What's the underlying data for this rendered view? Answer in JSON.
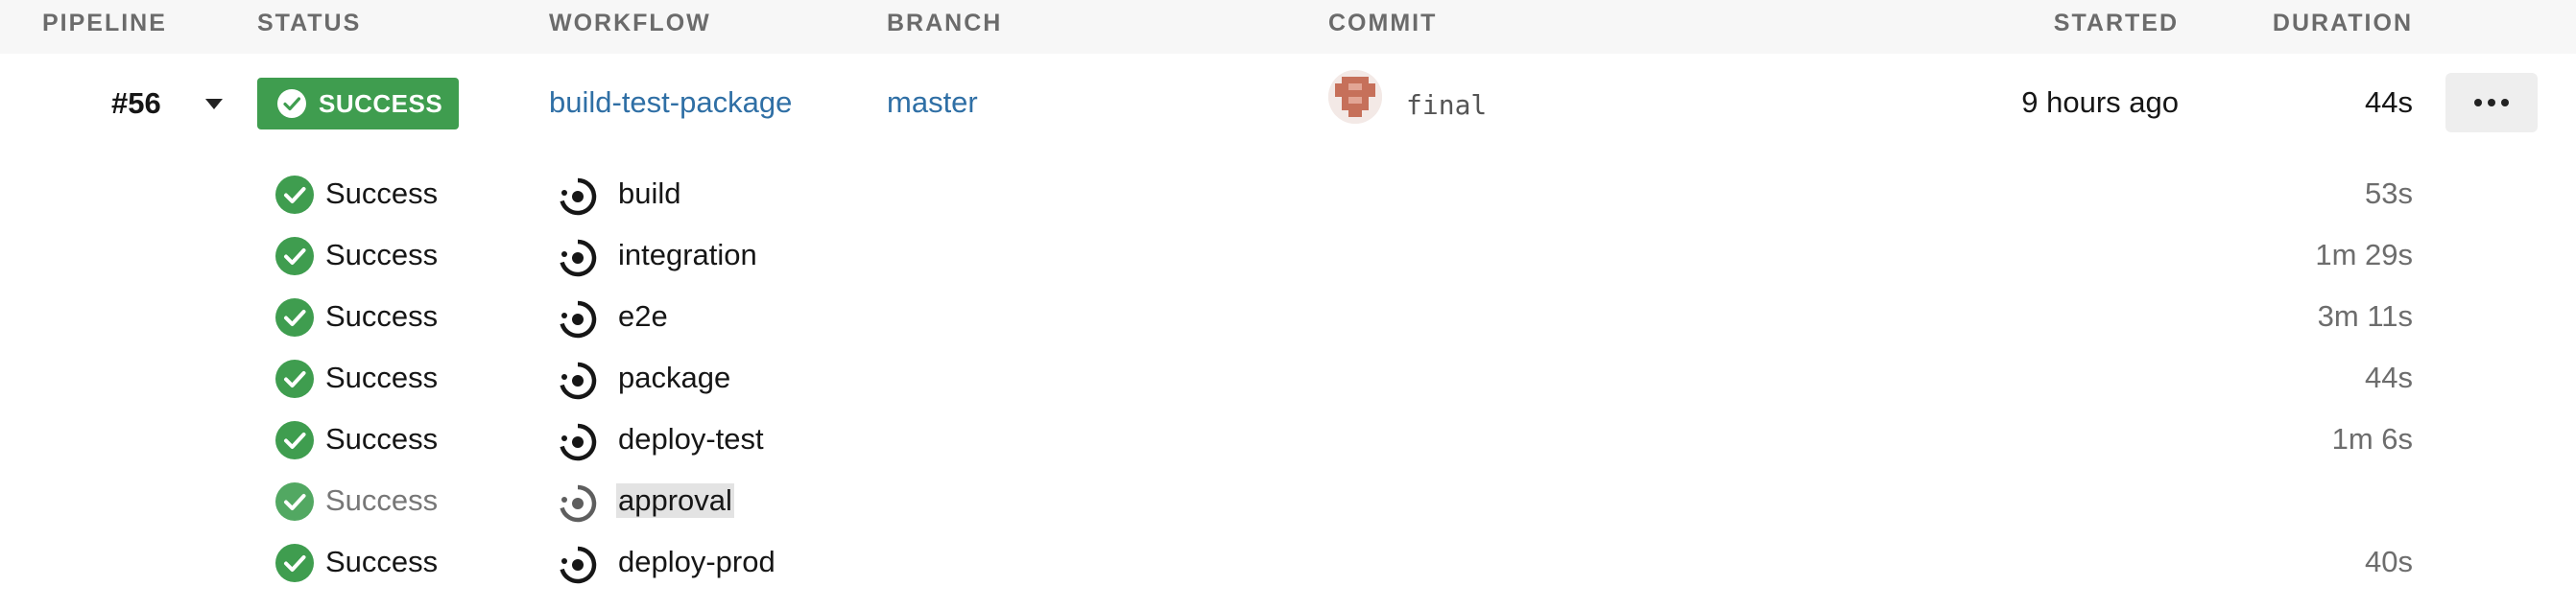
{
  "header": {
    "pipeline": "PIPELINE",
    "status": "STATUS",
    "workflow": "WORKFLOW",
    "branch": "BRANCH",
    "commit": "COMMIT",
    "started": "STARTED",
    "duration": "DURATION"
  },
  "pipeline": {
    "number": "#56",
    "status": "SUCCESS",
    "workflow": "build-test-package",
    "branch": "master",
    "commit": "final",
    "started": "9 hours ago",
    "duration": "44s"
  },
  "jobs": [
    {
      "status": "Success",
      "name": "build",
      "duration": "53s"
    },
    {
      "status": "Success",
      "name": "integration",
      "duration": "1m 29s"
    },
    {
      "status": "Success",
      "name": "e2e",
      "duration": "3m 11s"
    },
    {
      "status": "Success",
      "name": "package",
      "duration": "44s"
    },
    {
      "status": "Success",
      "name": "deploy-test",
      "duration": "1m 6s"
    },
    {
      "status": "Success",
      "name": "approval",
      "duration": ""
    },
    {
      "status": "Success",
      "name": "deploy-prod",
      "duration": "40s"
    }
  ],
  "icons": {
    "success": "check-circle-icon",
    "job": "job-circle-icon",
    "expand": "caret-down-icon",
    "more": "more-dots-icon"
  },
  "colors": {
    "success": "#3f9d4f",
    "link": "#2f6fa5",
    "header_bg": "#f7f7f7"
  }
}
